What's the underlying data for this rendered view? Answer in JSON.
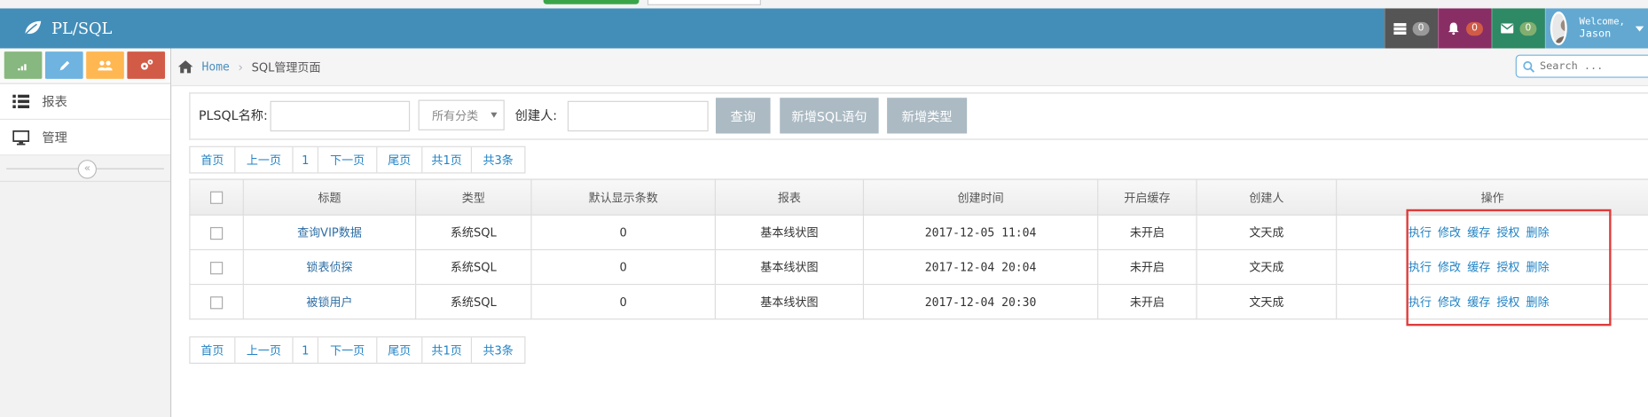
{
  "app": {
    "brand": "PL/SQL",
    "user_greeting": "Welcome,",
    "user_name": "Jason"
  },
  "badges": {
    "tasks": "0",
    "notifications": "0",
    "messages": "0"
  },
  "sidebar": {
    "menu": [
      {
        "label": "报表",
        "icon": "list-icon"
      },
      {
        "label": "管理",
        "icon": "desktop-icon"
      }
    ],
    "collapse_glyph": "«"
  },
  "breadcrumbs": {
    "home": "Home",
    "current": "SQL管理页面",
    "search_placeholder": "Search ..."
  },
  "filters": {
    "name_label": "PLSQL名称:",
    "category_placeholder": "所有分类",
    "creator_label": "创建人:",
    "query_button": "查询",
    "new_sql_button": "新增SQL语句",
    "new_type_button": "新增类型"
  },
  "pager": {
    "first": "首页",
    "prev": "上一页",
    "page": "1",
    "next": "下一页",
    "last": "尾页",
    "total_pages": "共1页",
    "total_rows": "共3条"
  },
  "table": {
    "headers": [
      "标题",
      "类型",
      "默认显示条数",
      "报表",
      "创建时间",
      "开启缓存",
      "创建人",
      "操作"
    ],
    "actions": [
      "执行",
      "修改",
      "缓存",
      "授权",
      "删除"
    ],
    "rows": [
      {
        "title": "查询VIP数据",
        "type": "系统SQL",
        "default_rows": "0",
        "report": "基本线状图",
        "created": "2017-12-05 11:04",
        "cache": "未开启",
        "creator": "文天成"
      },
      {
        "title": "锁表侦探",
        "type": "系统SQL",
        "default_rows": "0",
        "report": "基本线状图",
        "created": "2017-12-04 20:04",
        "cache": "未开启",
        "creator": "文天成"
      },
      {
        "title": "被锁用户",
        "type": "系统SQL",
        "default_rows": "0",
        "report": "基本线状图",
        "created": "2017-12-04 20:30",
        "cache": "未开启",
        "creator": "文天成"
      }
    ]
  },
  "colors": {
    "navbar": "#438eb9",
    "highlight": "#e03a3a",
    "link": "#2283c5",
    "button_grey": "#abbac3"
  }
}
